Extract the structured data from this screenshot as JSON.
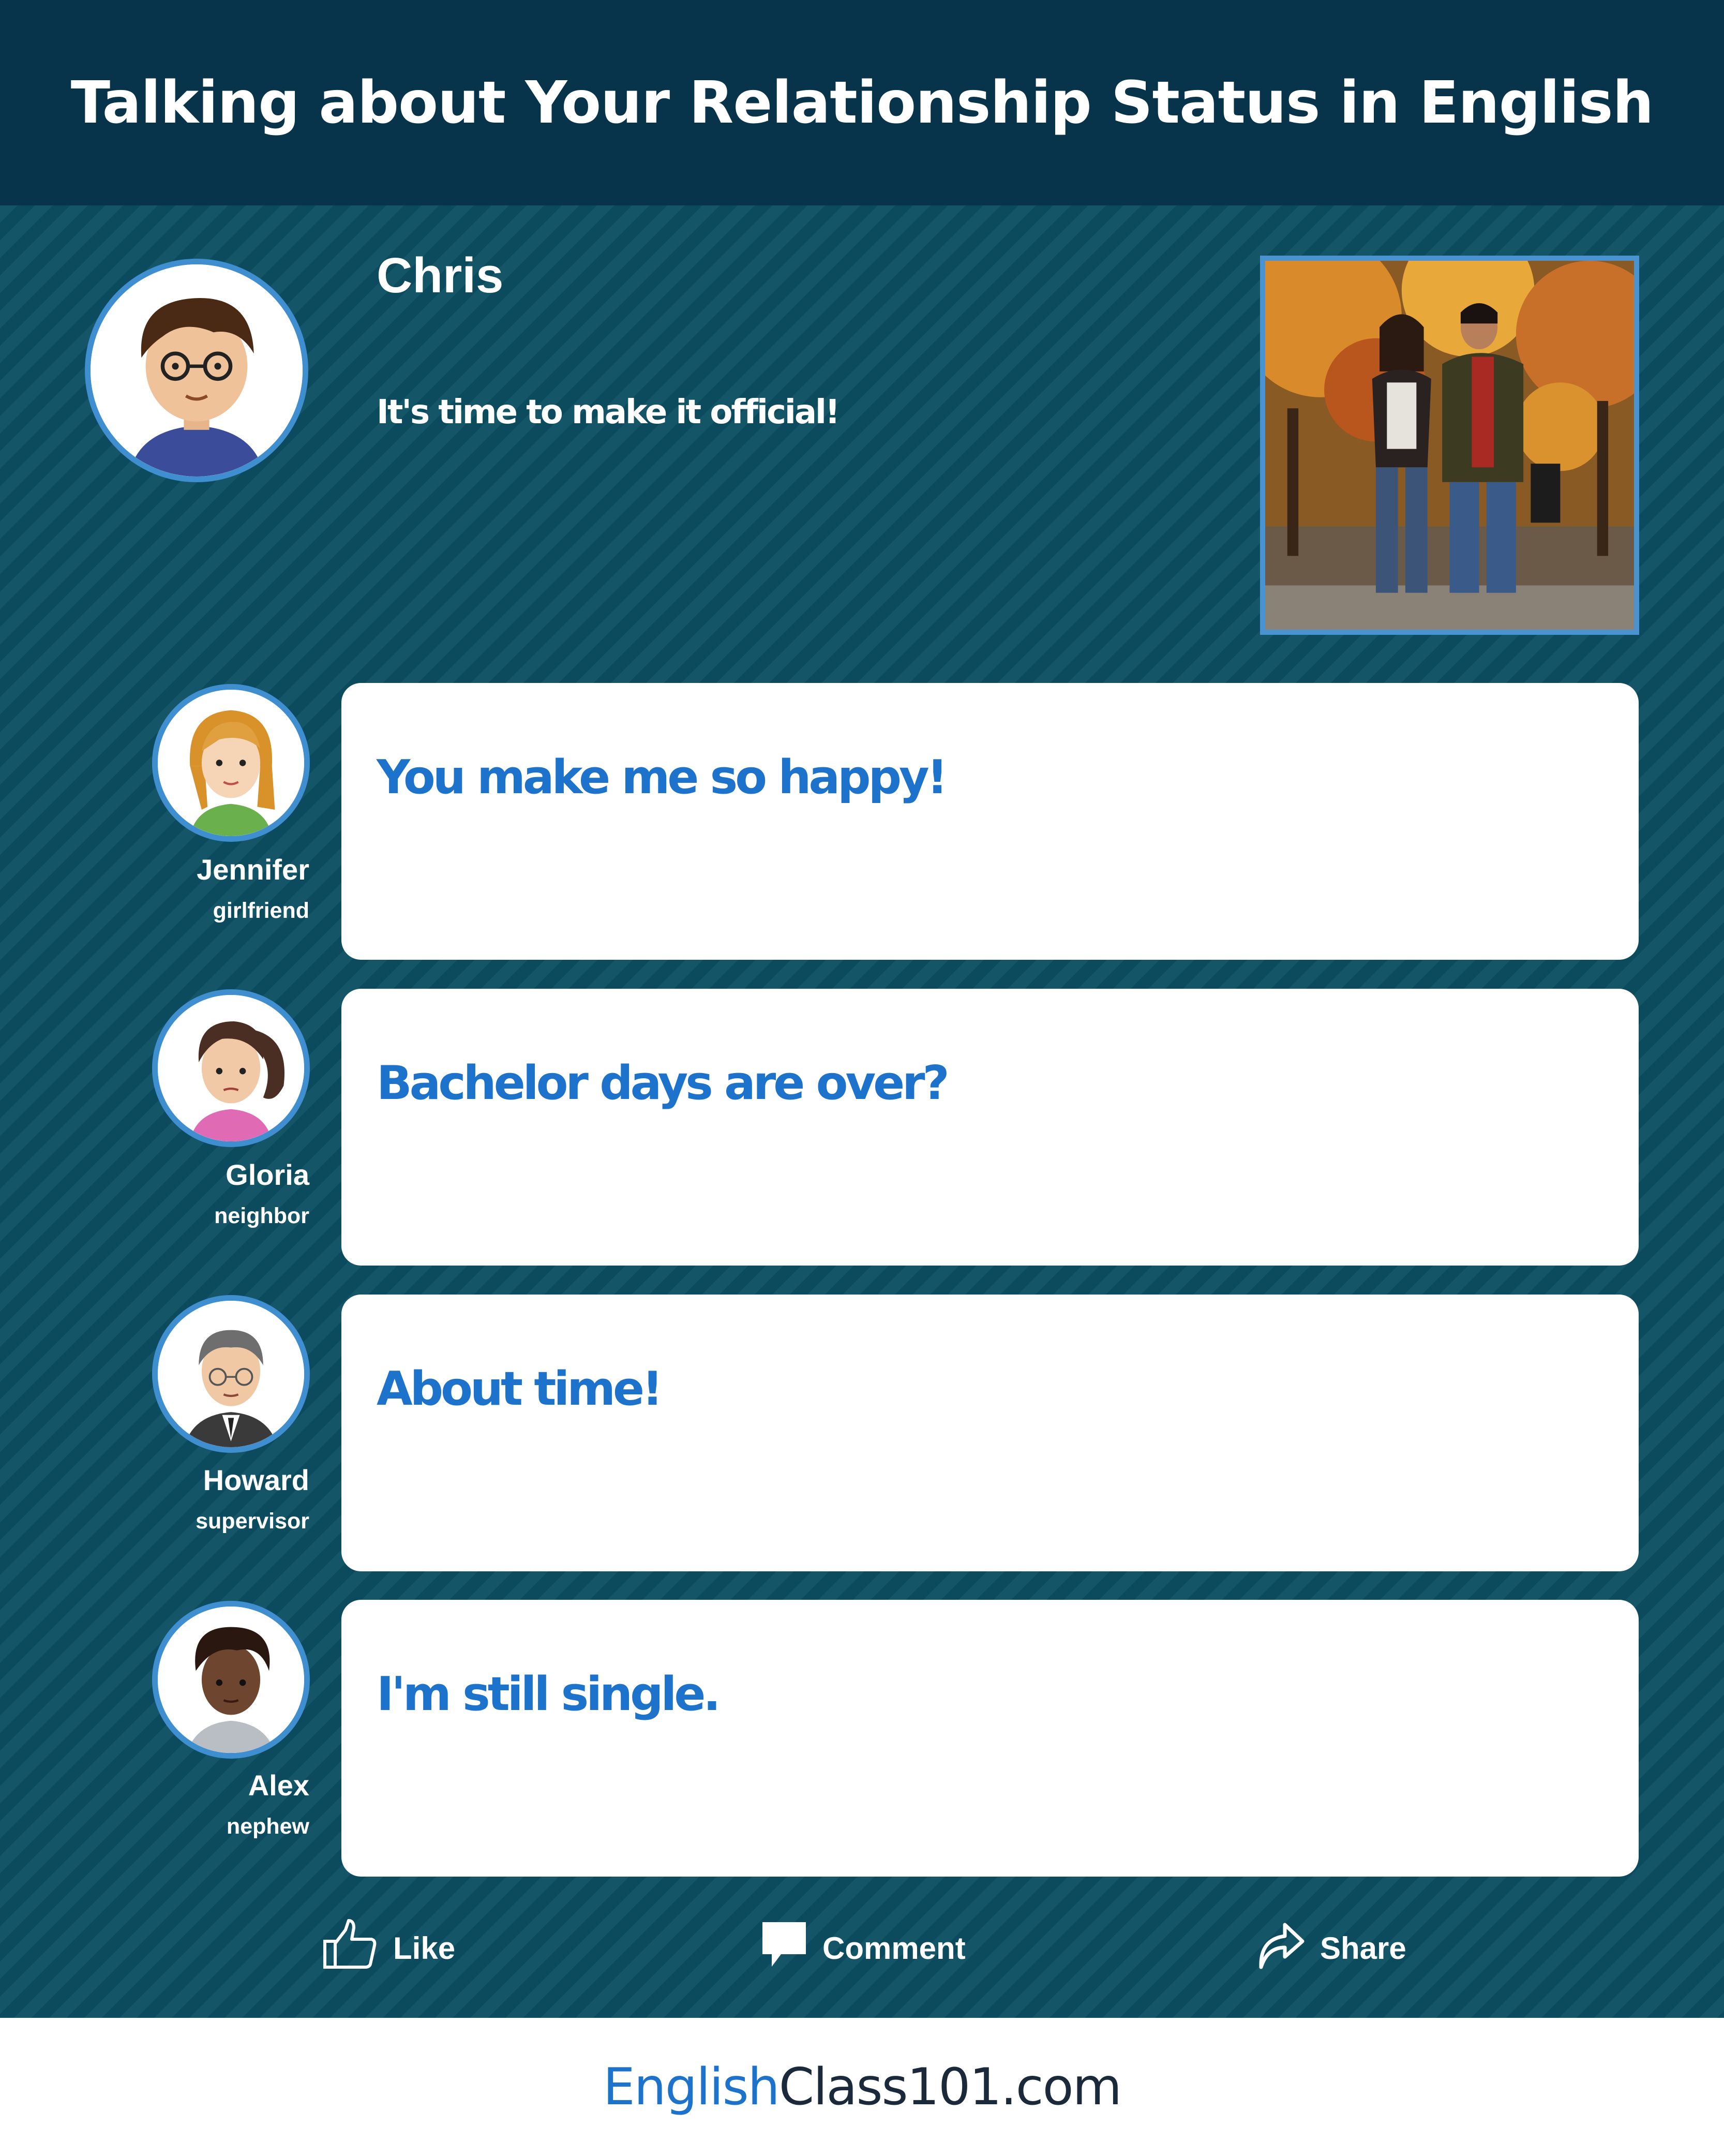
{
  "header": {
    "title": "Talking about Your Relationship Status in English"
  },
  "post": {
    "author": "Chris",
    "status": "It's time to make it official!",
    "photo": "couple-walking-autumn-photo"
  },
  "comments": [
    {
      "name": "Jennifer",
      "role": "girlfriend",
      "text": "You make me so happy!"
    },
    {
      "name": "Gloria",
      "role": "neighbor",
      "text": "Bachelor days are over?"
    },
    {
      "name": "Howard",
      "role": "supervisor",
      "text": "About time!"
    },
    {
      "name": "Alex",
      "role": "nephew",
      "text": "I'm still single."
    }
  ],
  "actions": {
    "like": "Like",
    "comment": "Comment",
    "share": "Share"
  },
  "footer": {
    "brand_part1": "English",
    "brand_part2": "Class101.com"
  },
  "colors": {
    "header_bg": "#07344a",
    "feed_bg": "#0c4f62",
    "accent_blue": "#1d73cc",
    "avatar_ring": "#3f8ed0"
  },
  "icons": [
    "thumbs-up-icon",
    "speech-bubble-icon",
    "share-arrow-icon"
  ]
}
